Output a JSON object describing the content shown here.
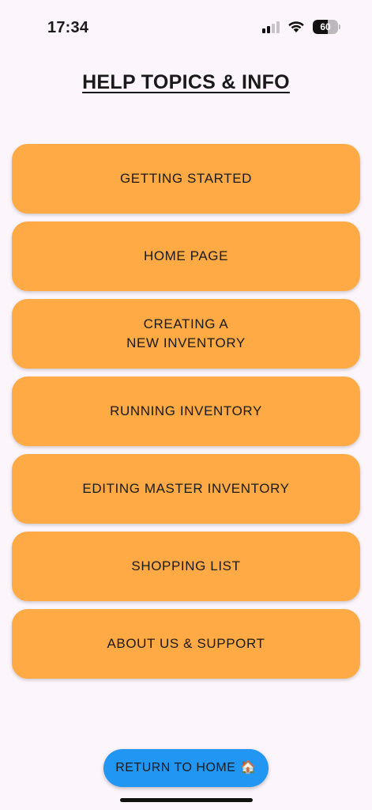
{
  "status_bar": {
    "time": "17:34",
    "battery_level": "60",
    "icons": [
      "cellular-signal-icon",
      "wifi-icon",
      "battery-icon"
    ]
  },
  "title": "HELP TOPICS & INFO",
  "topics": [
    "GETTING STARTED",
    "HOME PAGE",
    "CREATING A\nNEW INVENTORY",
    "RUNNING INVENTORY",
    "EDITING MASTER INVENTORY",
    "SHOPPING LIST",
    "ABOUT US & SUPPORT"
  ],
  "return_button": {
    "label": "RETURN TO HOME",
    "icon": "house-emoji-icon"
  },
  "colors": {
    "background": "#fcf5fb",
    "topic_button": "#ffaa44",
    "return_button": "#2196f3"
  }
}
